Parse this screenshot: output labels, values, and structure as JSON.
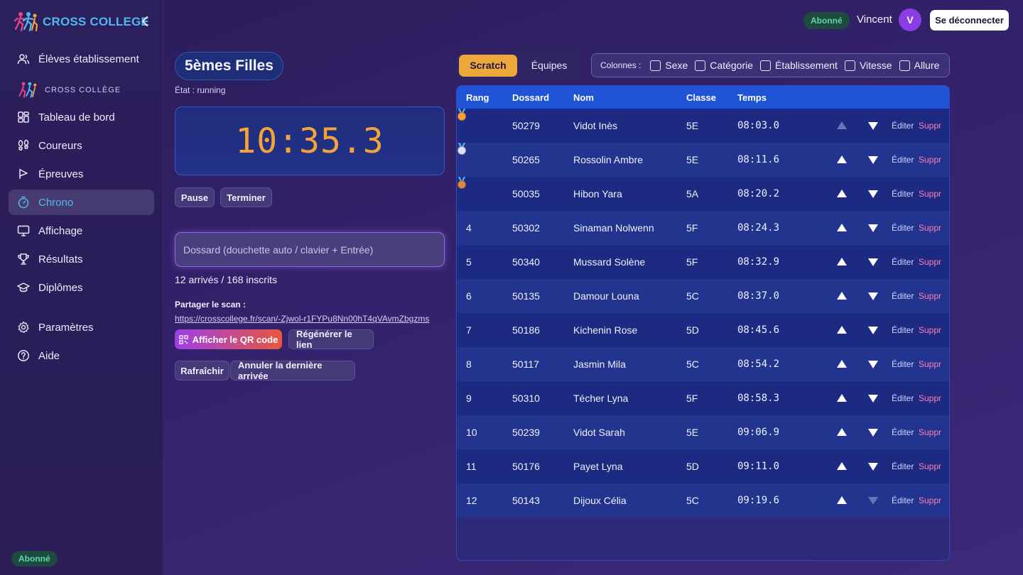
{
  "sidebar": {
    "brand": "CROSS COLLEGE",
    "pre_item": "Élèves établissement",
    "section_label": "CROSS COLLÈGE",
    "items": [
      {
        "label": "Tableau de bord",
        "icon": "dashboard-icon"
      },
      {
        "label": "Coureurs",
        "icon": "footprints-icon"
      },
      {
        "label": "Épreuves",
        "icon": "flag-icon"
      },
      {
        "label": "Chrono",
        "icon": "stopwatch-icon",
        "active": true
      },
      {
        "label": "Affichage",
        "icon": "monitor-icon"
      },
      {
        "label": "Résultats",
        "icon": "trophy-icon"
      },
      {
        "label": "Diplômes",
        "icon": "graduation-cap-icon"
      }
    ],
    "settings": "Paramètres",
    "help": "Aide",
    "bottom_badge": "Abonné"
  },
  "topbar": {
    "badge": "Abonné",
    "user": "Vincent",
    "avatar_initial": "V",
    "logout": "Se déconnecter"
  },
  "race": {
    "title": "5èmes Filles",
    "state": "État : running",
    "timer": "10:35.3",
    "pause": "Pause",
    "finish": "Terminer",
    "dossard_placeholder": "Dossard (douchette auto / clavier + Entrée)",
    "counts": "12 arrivés / 168 inscrits",
    "share_label": "Partager le scan :",
    "share_link": "https://crosscollege.fr/scan/-Zjwol-r1FYPu8Nn00hT4qVAvmZbgzms",
    "show_qr": "Afficher le QR code",
    "regen_link": "Régénérer le lien",
    "refresh": "Rafraîchir",
    "undo_last": "Annuler la dernière arrivée"
  },
  "tabs": {
    "scratch": "Scratch",
    "teams": "Équipes"
  },
  "columns": {
    "label": "Colonnes :",
    "options": [
      "Sexe",
      "Catégorie",
      "Établissement",
      "Vitesse",
      "Allure"
    ]
  },
  "table": {
    "headers": {
      "rank": "Rang",
      "bib": "Dossard",
      "name": "Nom",
      "class": "Classe",
      "time": "Temps"
    },
    "edit": "Éditer",
    "delete": "Suppr",
    "rows": [
      {
        "rank": "",
        "medal": "gold",
        "bib": "50279",
        "name": "Vidot Inès",
        "class": "5E",
        "time": "08:03.0"
      },
      {
        "rank": "",
        "medal": "silver",
        "bib": "50265",
        "name": "Rossolin Ambre",
        "class": "5E",
        "time": "08:11.6"
      },
      {
        "rank": "",
        "medal": "bronze",
        "bib": "50035",
        "name": "Hibon Yara",
        "class": "5A",
        "time": "08:20.2"
      },
      {
        "rank": "4",
        "bib": "50302",
        "name": "Sinaman Nolwenn",
        "class": "5F",
        "time": "08:24.3"
      },
      {
        "rank": "5",
        "bib": "50340",
        "name": "Mussard Solène",
        "class": "5F",
        "time": "08:32.9"
      },
      {
        "rank": "6",
        "bib": "50135",
        "name": "Damour Louna",
        "class": "5C",
        "time": "08:37.0"
      },
      {
        "rank": "7",
        "bib": "50186",
        "name": "Kichenin Rose",
        "class": "5D",
        "time": "08:45.6"
      },
      {
        "rank": "8",
        "bib": "50117",
        "name": "Jasmin Mila",
        "class": "5C",
        "time": "08:54.2"
      },
      {
        "rank": "9",
        "bib": "50310",
        "name": "Técher Lyna",
        "class": "5F",
        "time": "08:58.3"
      },
      {
        "rank": "10",
        "bib": "50239",
        "name": "Vidot Sarah",
        "class": "5E",
        "time": "09:06.9"
      },
      {
        "rank": "11",
        "bib": "50176",
        "name": "Payet Lyna",
        "class": "5D",
        "time": "09:11.0"
      },
      {
        "rank": "12",
        "bib": "50143",
        "name": "Dijoux Célia",
        "class": "5C",
        "time": "09:19.6"
      }
    ]
  }
}
